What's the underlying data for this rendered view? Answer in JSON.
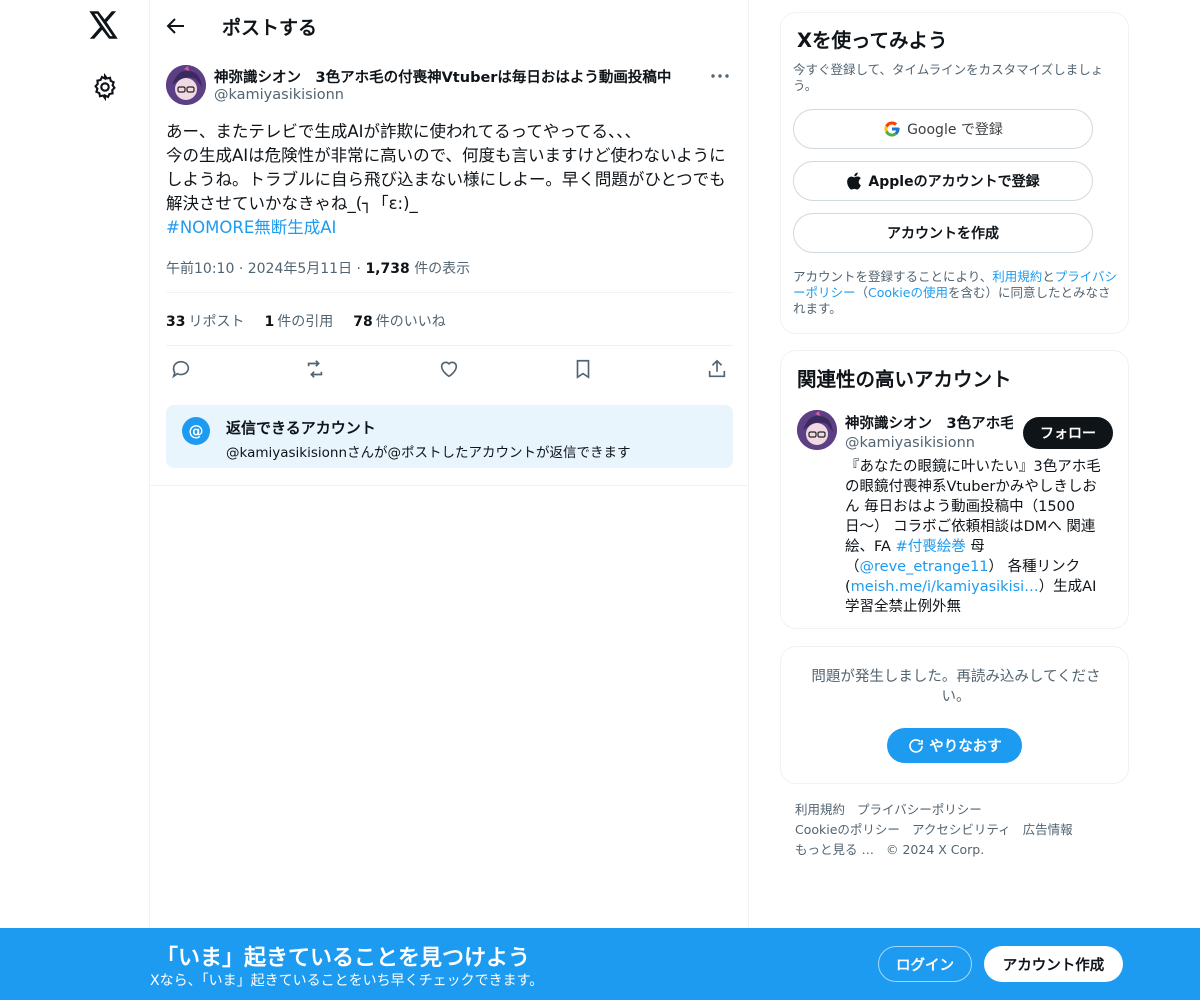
{
  "nav": {
    "logo_icon": "x-logo-icon",
    "settings_icon": "gear-icon"
  },
  "header": {
    "title": "ポストする",
    "back_icon": "back-arrow-icon"
  },
  "post": {
    "author_name": "神弥識シオン　3色アホ毛の付喪神Vtuberは毎日おはよう動画投稿中",
    "author_handle": "@kamiyasikisionn",
    "text": "あー、またテレビで生成AIが詐欺に使われてるってやってる、、、\n今の生成AIは危険性が非常に高いので、何度も言いますけど使わないようにしようね。トラブルに自ら飛び込まない様にしよー。早く問題がひとつでも解決させていかなきゃね_(┐「ε:)_",
    "hashtag": "#NOMORE無断生成AI",
    "time": "午前10:10",
    "date": "2024年5月11日",
    "views_count": "1,738",
    "views_label": "件の表示",
    "reposts_count": "33",
    "reposts_label": "リポスト",
    "quotes_count": "1",
    "quotes_label": "件の引用",
    "likes_count": "78",
    "likes_label": "件のいいね",
    "reply_restriction_title": "返信できるアカウント",
    "reply_restriction_desc": "@kamiyasikisionnさんが@ポストしたアカウントが返信できます"
  },
  "signup_card": {
    "title": "Xを使ってみよう",
    "subtitle": "今すぐ登録して、タイムラインをカスタマイズしましょう。",
    "google_label": "Google で登録",
    "apple_label": "Appleのアカウントで登録",
    "create_label": "アカウントを作成",
    "legal_prefix": "アカウントを登録することにより、",
    "legal_terms": "利用規約",
    "legal_and": "と",
    "legal_privacy": "プライバシーポリシー",
    "legal_mid": "（",
    "legal_cookie": "Cookieの使用",
    "legal_suffix": "を含む）に同意したとみなされます。"
  },
  "related_card": {
    "title": "関連性の高いアカウント",
    "name": "神弥識シオン　3色アホ毛の付喪神Vtuberは毎日おはよう動画投稿中",
    "handle": "@kamiyasikisionn",
    "follow_label": "フォロー",
    "bio_1": "『あなたの眼鏡に叶いたい』3色アホ毛の眼鏡付喪神系Vtuberかみやしきしおん 毎日おはよう動画投稿中（1500日〜） コラボご依頼相談はDMへ 関連絵、FA ",
    "bio_tag": "#付喪絵巻",
    "bio_2": " 母（",
    "bio_mention": "@reve_etrange11",
    "bio_3": "） 各種リンク(",
    "bio_link": "meish.me/i/kamiyasikisi…",
    "bio_4": "）生成AI学習全禁止例外無"
  },
  "error_card": {
    "text": "問題が発生しました。再読み込みしてください。",
    "retry_label": "やりなおす"
  },
  "footer": {
    "links": [
      "利用規約",
      "プライバシーポリシー",
      "Cookieのポリシー",
      "アクセシビリティ",
      "広告情報",
      "もっと見る …"
    ],
    "copyright": "© 2024 X Corp."
  },
  "bottom_bar": {
    "title": "「いま」起きていることを見つけよう",
    "subtitle": "Xなら、「いま」起きていることをいち早くチェックできます。",
    "login_label": "ログイン",
    "signup_label": "アカウント作成"
  }
}
